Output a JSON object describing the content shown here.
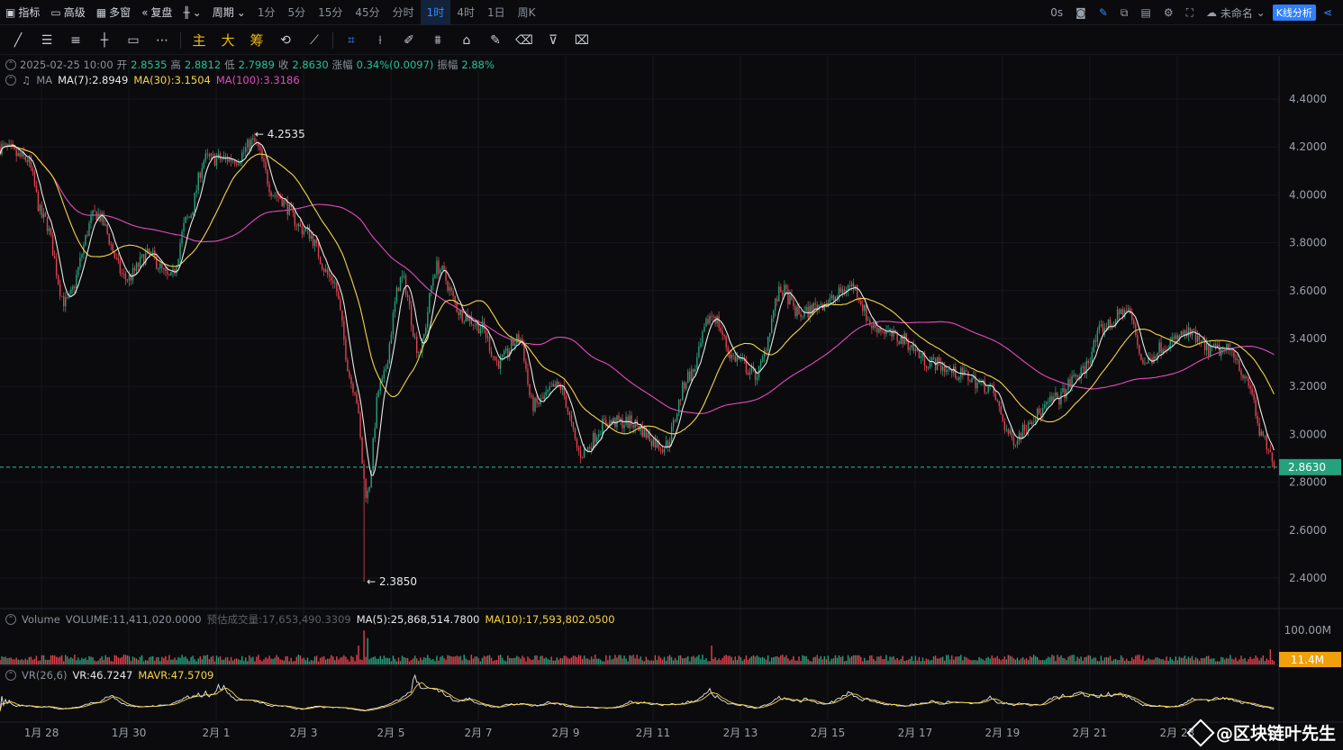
{
  "toolbar": {
    "indicators": "指标",
    "advanced": "高级",
    "multi_window": "多窗",
    "replay": "复盘",
    "period": "周期",
    "periods": [
      "1分",
      "5分",
      "15分",
      "45分",
      "分时",
      "1时",
      "4时",
      "1日",
      "周K"
    ],
    "active_period": "1时",
    "timer": "0s",
    "layout_name": "未命名",
    "kline_analysis": "K线分析"
  },
  "draw_tools": {
    "main": "主",
    "big": "大",
    "chips": "筹"
  },
  "info": {
    "datetime": "2025-02-25 10:00",
    "open_label": "开",
    "open": "2.8535",
    "high_label": "高",
    "high": "2.8812",
    "low_label": "低",
    "low": "2.7989",
    "close_label": "收",
    "close": "2.8630",
    "change_label": "涨幅",
    "change": "0.34%(0.0097)",
    "amplitude_label": "振幅",
    "amplitude": "2.88%"
  },
  "ma": {
    "name": "MA",
    "ma7": "MA(7):2.8949",
    "ma30": "MA(30):3.1504",
    "ma100": "MA(100):3.3186"
  },
  "volume_info": {
    "label": "Volume",
    "volume": "VOLUME:11,411,020.0000",
    "estimate": "预估成交量:17,653,490.3309",
    "ma5": "MA(5):25,868,514.7800",
    "ma10": "MA(10):17,593,802.0500"
  },
  "vr_info": {
    "label": "VR(26,6)",
    "vr": "VR:46.7247",
    "mavr": "MAVR:47.5709"
  },
  "colors": {
    "up": "#25a17d",
    "down": "#e0414f",
    "ma7": "#e8e8e8",
    "ma30": "#f5d547",
    "ma100": "#e44bbf",
    "accent": "#2f8cff"
  },
  "watermark": "@区块链叶先生",
  "chart_data": {
    "type": "candlestick",
    "symbol_interval": "1时",
    "y_axis_ticks": [
      "4.4000",
      "4.2000",
      "4.0000",
      "3.8000",
      "3.6000",
      "3.4000",
      "3.2000",
      "3.0000",
      "2.8000",
      "2.6000",
      "2.4000"
    ],
    "ylim": [
      2.35,
      4.48
    ],
    "current_price": "2.8630",
    "high_marker": "4.2535",
    "low_marker": "2.3850",
    "volume_axis_tick": "100.00M",
    "current_volume": "11.4M",
    "x_tick_labels": [
      "1月 28",
      "1月 30",
      "2月 1",
      "2月 3",
      "2月 5",
      "2月 7",
      "2月 9",
      "2月 11",
      "2月 13",
      "2月 15",
      "2月 17",
      "2月 19",
      "2月 21",
      "2月 23"
    ],
    "close_anchors": [
      {
        "day": 0.0,
        "price": 4.2
      },
      {
        "day": 0.6,
        "price": 4.15
      },
      {
        "day": 1.0,
        "price": 3.9
      },
      {
        "day": 1.5,
        "price": 3.55
      },
      {
        "day": 2.2,
        "price": 3.92
      },
      {
        "day": 2.9,
        "price": 3.65
      },
      {
        "day": 3.4,
        "price": 3.75
      },
      {
        "day": 3.9,
        "price": 3.65
      },
      {
        "day": 4.3,
        "price": 3.9
      },
      {
        "day": 4.7,
        "price": 4.15
      },
      {
        "day": 5.4,
        "price": 4.15
      },
      {
        "day": 5.8,
        "price": 4.22
      },
      {
        "day": 6.3,
        "price": 4.0
      },
      {
        "day": 7.0,
        "price": 3.85
      },
      {
        "day": 7.6,
        "price": 3.65
      },
      {
        "day": 8.1,
        "price": 3.2
      },
      {
        "day": 8.4,
        "price": 2.75
      },
      {
        "day": 8.7,
        "price": 3.2
      },
      {
        "day": 9.2,
        "price": 3.65
      },
      {
        "day": 9.6,
        "price": 3.35
      },
      {
        "day": 10.0,
        "price": 3.7
      },
      {
        "day": 10.6,
        "price": 3.5
      },
      {
        "day": 11.0,
        "price": 3.45
      },
      {
        "day": 11.4,
        "price": 3.3
      },
      {
        "day": 11.9,
        "price": 3.4
      },
      {
        "day": 12.2,
        "price": 3.12
      },
      {
        "day": 12.8,
        "price": 3.2
      },
      {
        "day": 13.3,
        "price": 2.92
      },
      {
        "day": 13.9,
        "price": 3.05
      },
      {
        "day": 14.4,
        "price": 3.05
      },
      {
        "day": 15.2,
        "price": 2.95
      },
      {
        "day": 15.8,
        "price": 3.25
      },
      {
        "day": 16.3,
        "price": 3.5
      },
      {
        "day": 16.8,
        "price": 3.32
      },
      {
        "day": 17.3,
        "price": 3.25
      },
      {
        "day": 17.9,
        "price": 3.6
      },
      {
        "day": 18.3,
        "price": 3.5
      },
      {
        "day": 18.9,
        "price": 3.55
      },
      {
        "day": 19.5,
        "price": 3.62
      },
      {
        "day": 20.0,
        "price": 3.45
      },
      {
        "day": 20.6,
        "price": 3.4
      },
      {
        "day": 21.3,
        "price": 3.3
      },
      {
        "day": 22.0,
        "price": 3.25
      },
      {
        "day": 22.6,
        "price": 3.2
      },
      {
        "day": 23.2,
        "price": 2.98
      },
      {
        "day": 23.7,
        "price": 3.08
      },
      {
        "day": 24.2,
        "price": 3.15
      },
      {
        "day": 24.7,
        "price": 3.25
      },
      {
        "day": 25.3,
        "price": 3.45
      },
      {
        "day": 25.8,
        "price": 3.52
      },
      {
        "day": 26.2,
        "price": 3.3
      },
      {
        "day": 26.7,
        "price": 3.38
      },
      {
        "day": 27.2,
        "price": 3.42
      },
      {
        "day": 27.7,
        "price": 3.35
      },
      {
        "day": 28.2,
        "price": 3.35
      },
      {
        "day": 28.6,
        "price": 3.2
      },
      {
        "day": 28.9,
        "price": 2.98
      },
      {
        "day": 29.2,
        "price": 2.86
      }
    ]
  }
}
